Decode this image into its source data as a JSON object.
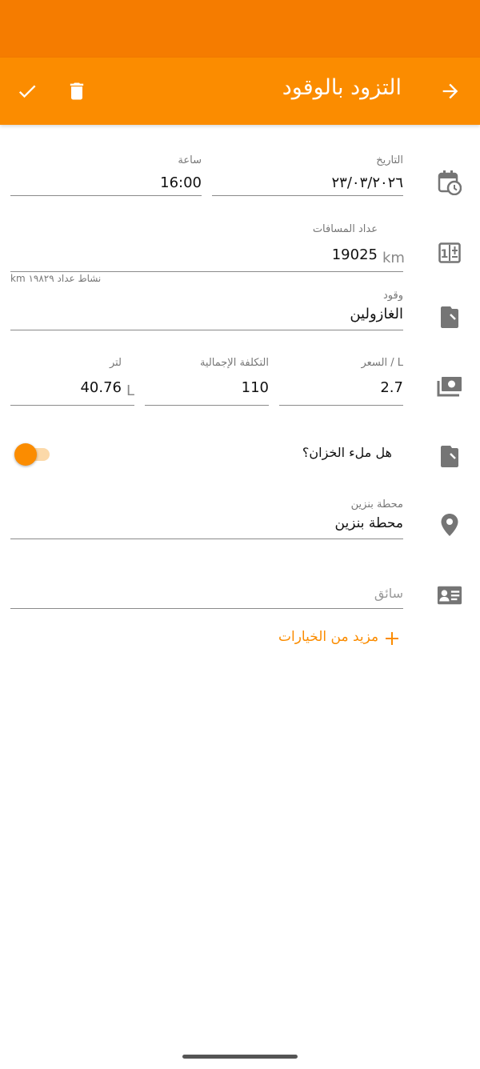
{
  "header": {
    "title": "التزود بالوقود"
  },
  "fields": {
    "date": {
      "label": "التاريخ",
      "value": "٢٣/٠٣/٢٠٢٦"
    },
    "time": {
      "label": "ساعة",
      "value": "16:00"
    },
    "odometer": {
      "label": "عداد المسافات",
      "value": "19025",
      "unit": "km",
      "helper": "نشاط عداد ١٩٨٢٩ km"
    },
    "fuel": {
      "label": "وقود",
      "value": "الغازولين"
    },
    "price": {
      "label": "السعر / L",
      "value": "2.7"
    },
    "total_cost": {
      "label": "التكلفة الإجمالية",
      "value": "110"
    },
    "liters": {
      "label": "لتر",
      "value": "40.76",
      "unit": "L"
    },
    "full_tank": {
      "label": "هل ملء الخزان؟",
      "checked": true
    },
    "station": {
      "label": "محطة بنزين",
      "value": "محطة بنزين"
    },
    "driver": {
      "placeholder": "سائق"
    }
  },
  "more_options": {
    "label": "مزيد من الخيارات",
    "icon": "plus-icon"
  },
  "colors": {
    "primary": "#fb8c00",
    "status_bar": "#f57c00",
    "icon_gray": "#757575"
  }
}
